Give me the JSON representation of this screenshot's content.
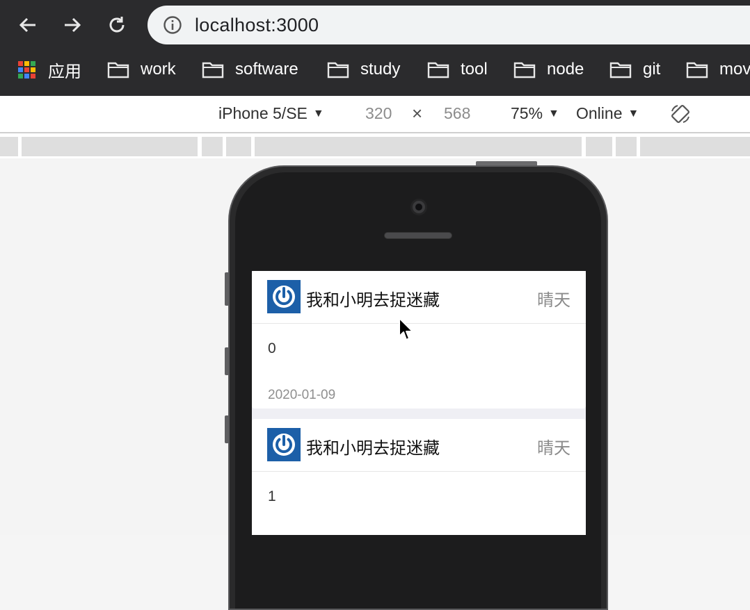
{
  "browser": {
    "url": "localhost:3000",
    "bookmarks": [
      {
        "label": "应用",
        "icon": "apps-grid-icon"
      },
      {
        "label": "work",
        "icon": "folder-icon"
      },
      {
        "label": "software",
        "icon": "folder-icon"
      },
      {
        "label": "study",
        "icon": "folder-icon"
      },
      {
        "label": "tool",
        "icon": "folder-icon"
      },
      {
        "label": "node",
        "icon": "folder-icon"
      },
      {
        "label": "git",
        "icon": "folder-icon"
      },
      {
        "label": "mov",
        "icon": "folder-icon"
      }
    ]
  },
  "device_toolbar": {
    "device": "iPhone 5/SE",
    "width": "320",
    "times": "×",
    "height": "568",
    "zoom": "75%",
    "network": "Online",
    "dropdown_arrow": "▼"
  },
  "cards": [
    {
      "title": "我和小明去捉迷藏",
      "extra": "晴天",
      "body": "0",
      "footer": "2020-01-09"
    },
    {
      "title": "我和小明去捉迷藏",
      "extra": "晴天",
      "body": "1",
      "footer": ""
    }
  ],
  "colors": {
    "topbar": "#2b2b2d",
    "thumb": "#1c5fa8"
  }
}
